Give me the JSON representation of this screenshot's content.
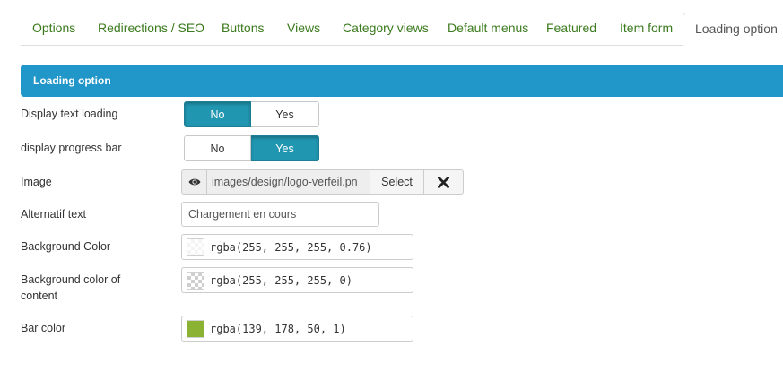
{
  "tabs": [
    {
      "label": "Options",
      "active": false
    },
    {
      "label": "Redirections / SEO",
      "active": false
    },
    {
      "label": "Buttons",
      "active": false
    },
    {
      "label": "Views",
      "active": false
    },
    {
      "label": "Category views",
      "active": false
    },
    {
      "label": "Default menus",
      "active": false
    },
    {
      "label": "Featured",
      "active": false
    },
    {
      "label": "Item form",
      "active": false
    },
    {
      "label": "Loading option",
      "active": true
    }
  ],
  "section": {
    "title": "Loading option"
  },
  "fields": {
    "display_text_loading": {
      "label": "Display text loading",
      "options": [
        "No",
        "Yes"
      ],
      "selected": "No"
    },
    "display_progress_bar": {
      "label": "display progress bar",
      "options": [
        "No",
        "Yes"
      ],
      "selected": "Yes"
    },
    "image": {
      "label": "Image",
      "path": "images/design/logo-verfeil.pn",
      "select_label": "Select",
      "preview_icon": "eye-icon",
      "clear_icon": "close-icon"
    },
    "alternatif_text": {
      "label": "Alternatif text",
      "value": "Chargement en cours"
    },
    "background_color": {
      "label": "Background Color",
      "value": "rgba(255, 255, 255, 0.76)",
      "swatch": "rgba(255, 255, 255, 0.76)"
    },
    "background_color_content": {
      "label_line1": "Background color of",
      "label_line2": "content",
      "value": "rgba(255, 255, 255, 0)",
      "swatch": "rgba(255, 255, 255, 0)"
    },
    "bar_color": {
      "label": "Bar color",
      "value": "rgba(139, 178, 50, 1)",
      "swatch": "rgba(139, 178, 50, 1)"
    }
  },
  "colors": {
    "accent": "#2196c8",
    "toggle_on": "#2196b0",
    "tab_link": "#3b7a1d"
  }
}
